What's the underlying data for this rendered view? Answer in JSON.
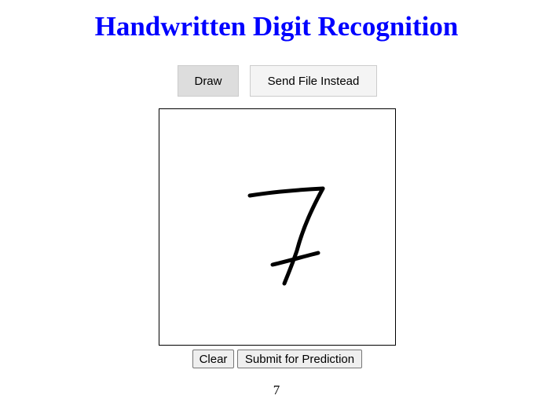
{
  "header": {
    "title": "Handwritten Digit Recognition",
    "title_color": "#0000ff"
  },
  "mode_tabs": {
    "draw_label": "Draw",
    "file_label": "Send File Instead",
    "active": "Draw"
  },
  "canvas": {
    "drawn_content": "handwritten digit 7",
    "stroke_color": "#000000"
  },
  "actions": {
    "clear_label": "Clear",
    "submit_label": "Submit for Prediction"
  },
  "prediction": {
    "result": "7"
  }
}
